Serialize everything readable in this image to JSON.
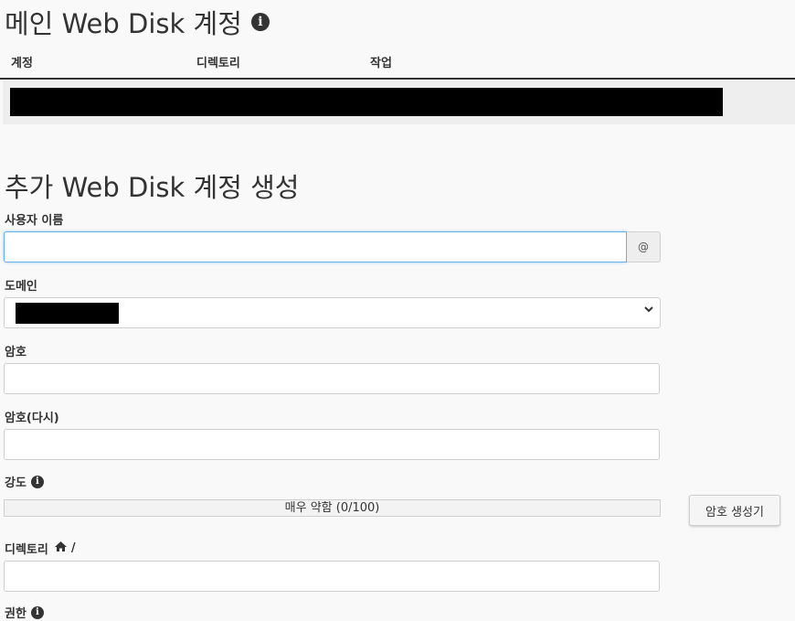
{
  "main_section": {
    "title": "메인 Web Disk 계정",
    "info_icon": "info-circle-icon",
    "table": {
      "columns": [
        "계정",
        "디렉토리",
        "작업"
      ]
    }
  },
  "create_section": {
    "title": "추가 Web Disk 계정 생성",
    "username": {
      "label": "사용자 이름",
      "value": "",
      "addon": "@"
    },
    "domain": {
      "label": "도메인"
    },
    "password": {
      "label": "암호",
      "value": ""
    },
    "password_again": {
      "label": "암호(다시)",
      "value": ""
    },
    "strength": {
      "label": "강도",
      "meter_text": "매우 약함 (0/100)",
      "level": 0
    },
    "generate_button": "암호 생성기",
    "directory": {
      "label": "디렉토리",
      "home_icon": "home-icon",
      "path": "/",
      "value": ""
    },
    "partial_label": "권한"
  }
}
